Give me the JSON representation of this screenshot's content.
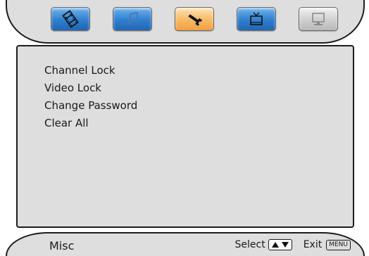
{
  "tabs": [
    {
      "icon": "film-icon",
      "color": "#2f7fcf",
      "active": false
    },
    {
      "icon": "music-note-icon",
      "color": "#2f7fcf",
      "active": false
    },
    {
      "icon": "wrench-icon",
      "color": "#f7b965",
      "active": true
    },
    {
      "icon": "tv-icon",
      "color": "#2f7fcf",
      "active": false
    },
    {
      "icon": "monitor-icon",
      "color": "#cfcfcf",
      "active": false
    }
  ],
  "menu": {
    "items": [
      "Channel Lock",
      "Video Lock",
      "Change Password",
      "Clear All"
    ]
  },
  "footer": {
    "title": "Misc",
    "select_label": "Select",
    "exit_label": "Exit",
    "menu_key": "MENU"
  }
}
